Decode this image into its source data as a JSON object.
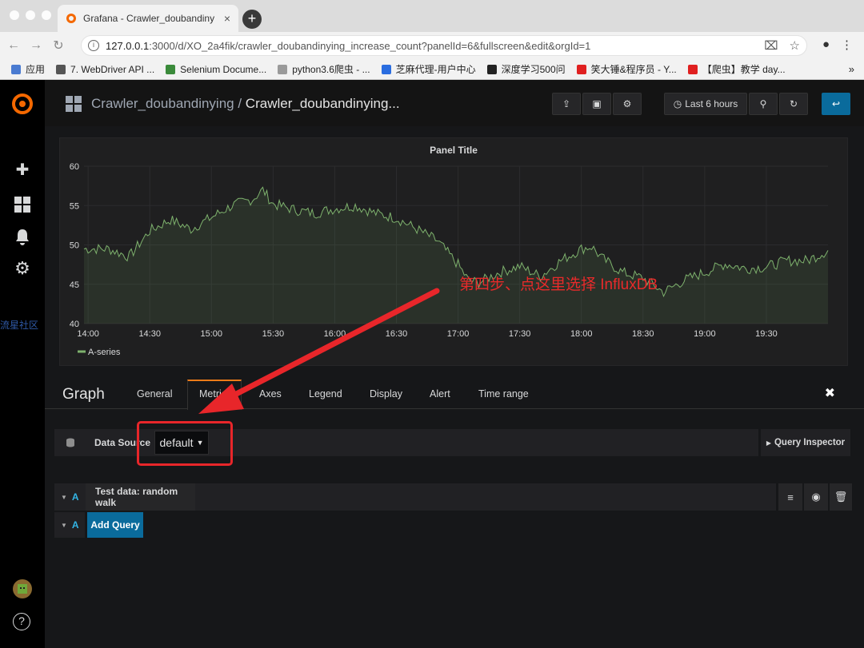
{
  "browser": {
    "tab_title": "Grafana - Crawler_doubandiny",
    "url_host": "127.0.0.1",
    "url_rest": ":3000/d/XO_2a4fik/crawler_doubandinying_increase_count?panelId=6&fullscreen&edit&orgId=1",
    "bookmarks": [
      {
        "label": "应用",
        "color": "#4a7bd1"
      },
      {
        "label": "7. WebDriver API ...",
        "color": "#555"
      },
      {
        "label": "Selenium Docume...",
        "color": "#3a8a3a"
      },
      {
        "label": "python3.6爬虫 - ...",
        "color": "#9a9a9a"
      },
      {
        "label": "芝麻代理-用户中心",
        "color": "#2a6de0"
      },
      {
        "label": "深度学习500问",
        "color": "#222"
      },
      {
        "label": "笑大锤&程序员 - Y...",
        "color": "#e02020"
      },
      {
        "label": "【爬虫】教学 day...",
        "color": "#e02020"
      }
    ],
    "more": "»"
  },
  "sidebar": {
    "watermark": "流星社区"
  },
  "navbar": {
    "breadcrumb_folder": "Crawler_doubandinying",
    "breadcrumb_sep": " / ",
    "breadcrumb_dash": "Crawler_doubandinying...",
    "time_range": "Last 6 hours"
  },
  "panel": {
    "title": "Panel Title"
  },
  "chart_data": {
    "type": "line",
    "title": "Panel Title",
    "xlabel": "",
    "ylabel": "",
    "ylim": [
      40,
      60
    ],
    "y_ticks": [
      "60",
      "55",
      "50",
      "45",
      "40"
    ],
    "x_ticks": [
      "14:00",
      "14:30",
      "15:00",
      "15:30",
      "16:00",
      "16:30",
      "17:00",
      "17:30",
      "18:00",
      "18:30",
      "19:00",
      "19:30"
    ],
    "x_range": [
      "13:58",
      "20:00"
    ],
    "grid": true,
    "legend": "bottom-left",
    "color": "#7eb26d",
    "series": [
      {
        "name": "A-series",
        "x": [
          "13:58",
          "14:10",
          "14:20",
          "14:30",
          "14:40",
          "14:50",
          "15:00",
          "15:10",
          "15:20",
          "15:25",
          "15:30",
          "15:40",
          "15:50",
          "16:00",
          "16:10",
          "16:20",
          "16:30",
          "16:40",
          "16:50",
          "17:00",
          "17:05",
          "17:10",
          "17:20",
          "17:30",
          "17:40",
          "17:50",
          "18:00",
          "18:05",
          "18:10",
          "18:20",
          "18:30",
          "18:40",
          "18:50",
          "19:00",
          "19:10",
          "19:20",
          "19:30",
          "19:40",
          "19:50",
          "20:00"
        ],
        "values": [
          49.5,
          49.5,
          48.5,
          51.8,
          53.2,
          52.0,
          53.5,
          55.0,
          55.8,
          57.0,
          55.2,
          54.5,
          54.0,
          54.6,
          55.0,
          54.0,
          53.4,
          52.0,
          50.5,
          47.5,
          45.5,
          45.2,
          46.5,
          47.3,
          46.0,
          48.0,
          49.5,
          49.8,
          48.3,
          46.5,
          45.8,
          44.0,
          45.5,
          46.5,
          47.6,
          47.0,
          47.2,
          48.0,
          48.0,
          49.3
        ]
      }
    ]
  },
  "editor": {
    "title": "Graph",
    "tabs": [
      "General",
      "Metrics",
      "Axes",
      "Legend",
      "Display",
      "Alert",
      "Time range"
    ],
    "close": "✖",
    "datasource_label": "Data Source",
    "datasource_value": "default",
    "query_inspector": "Query Inspector",
    "query_ref": "A",
    "query_label": "Test data: random walk",
    "add_ref": "A",
    "add_query": "Add Query"
  },
  "annotation": {
    "text": "第四步、点这里选择 InfluxDB"
  }
}
